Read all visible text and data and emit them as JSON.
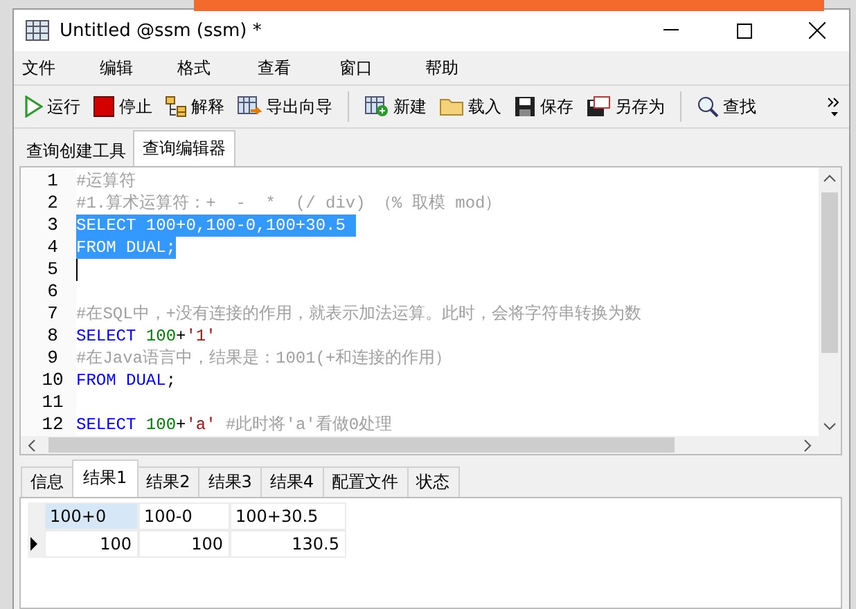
{
  "window": {
    "title": "Untitled @ssm (ssm) *"
  },
  "menu": [
    "文件",
    "编辑",
    "格式",
    "查看",
    "窗口",
    "帮助"
  ],
  "toolbar": [
    {
      "kind": "run",
      "label": "运行"
    },
    {
      "kind": "stop",
      "label": "停止"
    },
    {
      "kind": "explain",
      "label": "解释"
    },
    {
      "kind": "export",
      "label": "导出向导"
    },
    {
      "kind": "separator"
    },
    {
      "kind": "new",
      "label": "新建"
    },
    {
      "kind": "load",
      "label": "载入"
    },
    {
      "kind": "save",
      "label": "保存"
    },
    {
      "kind": "saveas",
      "label": "另存为"
    },
    {
      "kind": "separator"
    },
    {
      "kind": "find",
      "label": "查找"
    }
  ],
  "tabs": [
    {
      "label": "查询创建工具",
      "selected": false
    },
    {
      "label": "查询编辑器",
      "selected": true
    }
  ],
  "editor": {
    "lines": [
      {
        "number": "1",
        "selected": false,
        "cursor": false,
        "segments": [
          {
            "kind": "comment",
            "text": "#运算符"
          }
        ]
      },
      {
        "number": "2",
        "selected": false,
        "cursor": false,
        "segments": [
          {
            "kind": "comment",
            "text": "#1.算术运算符：+  -  *  (/ div) （% 取模 mod）"
          }
        ]
      },
      {
        "number": "3",
        "selected": true,
        "cursor": false,
        "segments": [
          {
            "kind": "plain",
            "text": "SELECT 100+0,100-0,100+30.5 "
          }
        ]
      },
      {
        "number": "4",
        "selected": true,
        "cursor": false,
        "segments": [
          {
            "kind": "plain",
            "text": "FROM DUAL;"
          }
        ]
      },
      {
        "number": "5",
        "selected": false,
        "cursor": true
      },
      {
        "number": "6",
        "selected": false,
        "cursor": false
      },
      {
        "number": "7",
        "selected": false,
        "cursor": false,
        "segments": [
          {
            "kind": "comment",
            "text": "#在SQL中，+没有连接的作用，就表示加法运算。此时，会将字符串转换为数"
          }
        ]
      },
      {
        "number": "8",
        "selected": false,
        "cursor": false,
        "segments": [
          {
            "kind": "keyword",
            "text": "SELECT "
          },
          {
            "kind": "number",
            "text": "100"
          },
          {
            "kind": "plain",
            "text": "+"
          },
          {
            "kind": "string",
            "text": "'1'"
          }
        ]
      },
      {
        "number": "9",
        "selected": false,
        "cursor": false,
        "segments": [
          {
            "kind": "comment",
            "text": "#在Java语言中，结果是：1001(+和连接的作用）"
          }
        ]
      },
      {
        "number": "10",
        "selected": false,
        "cursor": false,
        "segments": [
          {
            "kind": "keyword",
            "text": "FROM DUAL"
          },
          {
            "kind": "plain",
            "text": ";"
          }
        ]
      },
      {
        "number": "11",
        "selected": false,
        "cursor": false
      },
      {
        "number": "12",
        "selected": false,
        "cursor": false,
        "segments": [
          {
            "kind": "keyword",
            "text": "SELECT "
          },
          {
            "kind": "number",
            "text": "100"
          },
          {
            "kind": "plain",
            "text": "+"
          },
          {
            "kind": "string",
            "text": "'a' "
          },
          {
            "kind": "comment",
            "text": "#此时将'a'看做0处理"
          }
        ]
      }
    ]
  },
  "result_tabs": [
    {
      "label": "信息",
      "selected": false
    },
    {
      "label": "结果1",
      "selected": true
    },
    {
      "label": "结果2",
      "selected": false
    },
    {
      "label": "结果3",
      "selected": false
    },
    {
      "label": "结果4",
      "selected": false
    },
    {
      "label": "配置文件",
      "selected": false
    },
    {
      "label": "状态",
      "selected": false
    }
  ],
  "grid": {
    "columns": [
      {
        "label": "100+0",
        "selected": true
      },
      {
        "label": "100-0",
        "selected": false
      },
      {
        "label": "100+30.5",
        "selected": false
      }
    ],
    "rows": [
      {
        "current": true,
        "cells": [
          "100",
          "100",
          "130.5"
        ]
      }
    ]
  }
}
